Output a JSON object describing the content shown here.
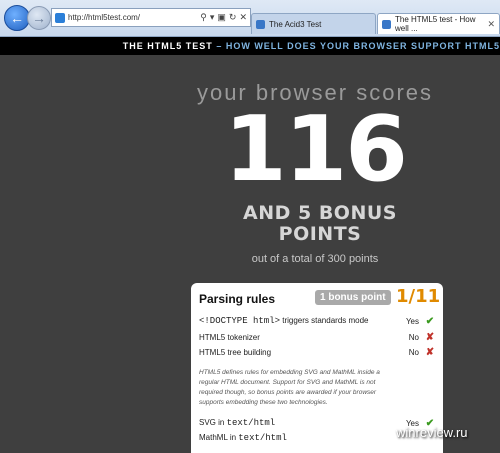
{
  "browser": {
    "url": "http://html5test.com/",
    "tabs": [
      {
        "label": "The Acid3 Test"
      },
      {
        "label": "The HTML5 test - How well ..."
      }
    ]
  },
  "site": {
    "title": "THE HTML5 TEST",
    "subtitle": "– HOW WELL DOES YOUR BROWSER SUPPORT HTML5"
  },
  "score": {
    "label": "your browser scores",
    "value": "116",
    "bonus": "AND 5 BONUS POINTS",
    "total": "out of a total of 300 points"
  },
  "panel": {
    "title": "Parsing rules",
    "bonus_badge": "1 bonus point",
    "score": "1/11",
    "rows": [
      {
        "prefix": "<!DOCTYPE html>",
        "label": " triggers standards mode",
        "result": "Yes",
        "ok": true
      },
      {
        "label": "HTML5 tokenizer",
        "result": "No",
        "ok": false
      },
      {
        "label": "HTML5 tree building",
        "result": "No",
        "ok": false
      }
    ],
    "note": "HTML5 defines rules for embedding SVG and MathML inside a regular HTML document. Support for SVG and MathML is not required though, so bonus points are awarded if your browser supports embedding these two technologies.",
    "bonus_rows": [
      {
        "label": "SVG in ",
        "code": "text/html",
        "result": "Yes",
        "ok": true
      },
      {
        "label": "MathML in ",
        "code": "text/html"
      }
    ]
  },
  "watermark": "winreview.ru",
  "colors": {
    "yes": "#3a9a1f",
    "no": "#c0322a",
    "accent": "#e08a00"
  }
}
